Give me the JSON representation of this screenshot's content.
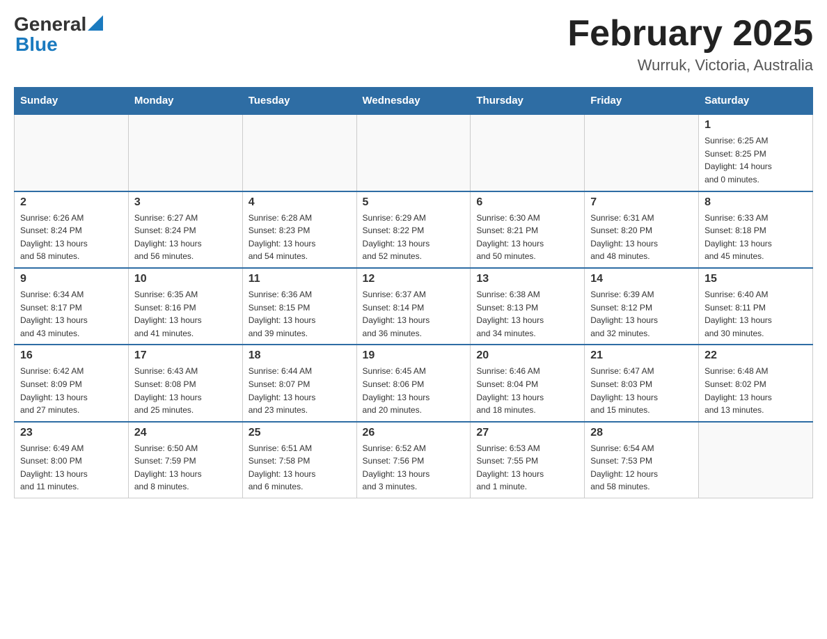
{
  "header": {
    "logo_general": "General",
    "logo_blue": "Blue",
    "title": "February 2025",
    "subtitle": "Wurruk, Victoria, Australia"
  },
  "weekdays": [
    "Sunday",
    "Monday",
    "Tuesday",
    "Wednesday",
    "Thursday",
    "Friday",
    "Saturday"
  ],
  "weeks": [
    [
      {
        "day": "",
        "info": ""
      },
      {
        "day": "",
        "info": ""
      },
      {
        "day": "",
        "info": ""
      },
      {
        "day": "",
        "info": ""
      },
      {
        "day": "",
        "info": ""
      },
      {
        "day": "",
        "info": ""
      },
      {
        "day": "1",
        "info": "Sunrise: 6:25 AM\nSunset: 8:25 PM\nDaylight: 14 hours\nand 0 minutes."
      }
    ],
    [
      {
        "day": "2",
        "info": "Sunrise: 6:26 AM\nSunset: 8:24 PM\nDaylight: 13 hours\nand 58 minutes."
      },
      {
        "day": "3",
        "info": "Sunrise: 6:27 AM\nSunset: 8:24 PM\nDaylight: 13 hours\nand 56 minutes."
      },
      {
        "day": "4",
        "info": "Sunrise: 6:28 AM\nSunset: 8:23 PM\nDaylight: 13 hours\nand 54 minutes."
      },
      {
        "day": "5",
        "info": "Sunrise: 6:29 AM\nSunset: 8:22 PM\nDaylight: 13 hours\nand 52 minutes."
      },
      {
        "day": "6",
        "info": "Sunrise: 6:30 AM\nSunset: 8:21 PM\nDaylight: 13 hours\nand 50 minutes."
      },
      {
        "day": "7",
        "info": "Sunrise: 6:31 AM\nSunset: 8:20 PM\nDaylight: 13 hours\nand 48 minutes."
      },
      {
        "day": "8",
        "info": "Sunrise: 6:33 AM\nSunset: 8:18 PM\nDaylight: 13 hours\nand 45 minutes."
      }
    ],
    [
      {
        "day": "9",
        "info": "Sunrise: 6:34 AM\nSunset: 8:17 PM\nDaylight: 13 hours\nand 43 minutes."
      },
      {
        "day": "10",
        "info": "Sunrise: 6:35 AM\nSunset: 8:16 PM\nDaylight: 13 hours\nand 41 minutes."
      },
      {
        "day": "11",
        "info": "Sunrise: 6:36 AM\nSunset: 8:15 PM\nDaylight: 13 hours\nand 39 minutes."
      },
      {
        "day": "12",
        "info": "Sunrise: 6:37 AM\nSunset: 8:14 PM\nDaylight: 13 hours\nand 36 minutes."
      },
      {
        "day": "13",
        "info": "Sunrise: 6:38 AM\nSunset: 8:13 PM\nDaylight: 13 hours\nand 34 minutes."
      },
      {
        "day": "14",
        "info": "Sunrise: 6:39 AM\nSunset: 8:12 PM\nDaylight: 13 hours\nand 32 minutes."
      },
      {
        "day": "15",
        "info": "Sunrise: 6:40 AM\nSunset: 8:11 PM\nDaylight: 13 hours\nand 30 minutes."
      }
    ],
    [
      {
        "day": "16",
        "info": "Sunrise: 6:42 AM\nSunset: 8:09 PM\nDaylight: 13 hours\nand 27 minutes."
      },
      {
        "day": "17",
        "info": "Sunrise: 6:43 AM\nSunset: 8:08 PM\nDaylight: 13 hours\nand 25 minutes."
      },
      {
        "day": "18",
        "info": "Sunrise: 6:44 AM\nSunset: 8:07 PM\nDaylight: 13 hours\nand 23 minutes."
      },
      {
        "day": "19",
        "info": "Sunrise: 6:45 AM\nSunset: 8:06 PM\nDaylight: 13 hours\nand 20 minutes."
      },
      {
        "day": "20",
        "info": "Sunrise: 6:46 AM\nSunset: 8:04 PM\nDaylight: 13 hours\nand 18 minutes."
      },
      {
        "day": "21",
        "info": "Sunrise: 6:47 AM\nSunset: 8:03 PM\nDaylight: 13 hours\nand 15 minutes."
      },
      {
        "day": "22",
        "info": "Sunrise: 6:48 AM\nSunset: 8:02 PM\nDaylight: 13 hours\nand 13 minutes."
      }
    ],
    [
      {
        "day": "23",
        "info": "Sunrise: 6:49 AM\nSunset: 8:00 PM\nDaylight: 13 hours\nand 11 minutes."
      },
      {
        "day": "24",
        "info": "Sunrise: 6:50 AM\nSunset: 7:59 PM\nDaylight: 13 hours\nand 8 minutes."
      },
      {
        "day": "25",
        "info": "Sunrise: 6:51 AM\nSunset: 7:58 PM\nDaylight: 13 hours\nand 6 minutes."
      },
      {
        "day": "26",
        "info": "Sunrise: 6:52 AM\nSunset: 7:56 PM\nDaylight: 13 hours\nand 3 minutes."
      },
      {
        "day": "27",
        "info": "Sunrise: 6:53 AM\nSunset: 7:55 PM\nDaylight: 13 hours\nand 1 minute."
      },
      {
        "day": "28",
        "info": "Sunrise: 6:54 AM\nSunset: 7:53 PM\nDaylight: 12 hours\nand 58 minutes."
      },
      {
        "day": "",
        "info": ""
      }
    ]
  ]
}
